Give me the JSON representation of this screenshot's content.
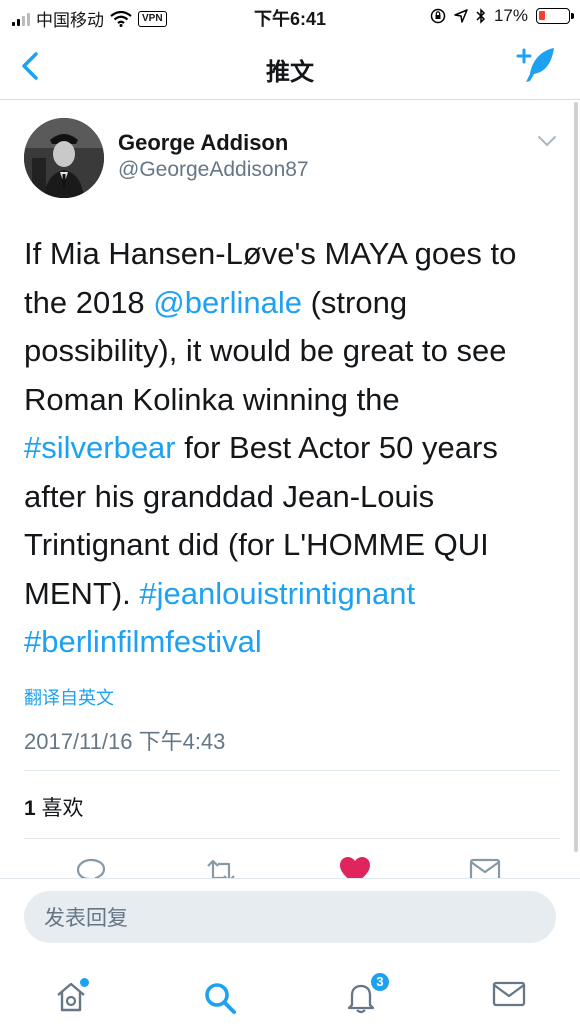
{
  "status_bar": {
    "carrier": "中国移动",
    "vpn": "VPN",
    "time": "下午6:41",
    "battery": "17%"
  },
  "nav": {
    "title": "推文",
    "back_icon": "chevron-left-icon",
    "compose_icon": "compose-feather-icon"
  },
  "tweet": {
    "author_name": "George Addison",
    "author_handle": "@GeorgeAddison87",
    "lines": [
      [
        "If Mia Hansen-Løve's MAYA goes to"
      ],
      [
        "the 2018 ",
        "@berlinale",
        " (strong"
      ],
      [
        "possibility), it would be great to see"
      ],
      [
        "Roman Kolinka winning the"
      ],
      [
        "#silverbear",
        " for Best Actor 50 years"
      ],
      [
        "after his granddad Jean-Louis"
      ],
      [
        "Trintignant did (for L'HOMME QUI"
      ],
      [
        "MENT). ",
        "#jeanlouistrintignant"
      ],
      [
        "#berlinfilmfestival"
      ]
    ],
    "translate_label": "翻译自英文",
    "timestamp": "2017/11/16 下午4:43",
    "likes_count": "1",
    "likes_label": "喜欢"
  },
  "reply": {
    "placeholder": "发表回复"
  },
  "tabs": [
    {
      "name": "home",
      "icon": "home-icon",
      "has_dot": true
    },
    {
      "name": "search",
      "icon": "search-icon",
      "active": true
    },
    {
      "name": "notifications",
      "icon": "bell-icon",
      "badge": "3"
    },
    {
      "name": "messages",
      "icon": "mail-icon"
    }
  ],
  "colors": {
    "accent": "#1da1f2",
    "text": "#14171a",
    "muted": "#657786",
    "like_red": "#e0245e"
  }
}
